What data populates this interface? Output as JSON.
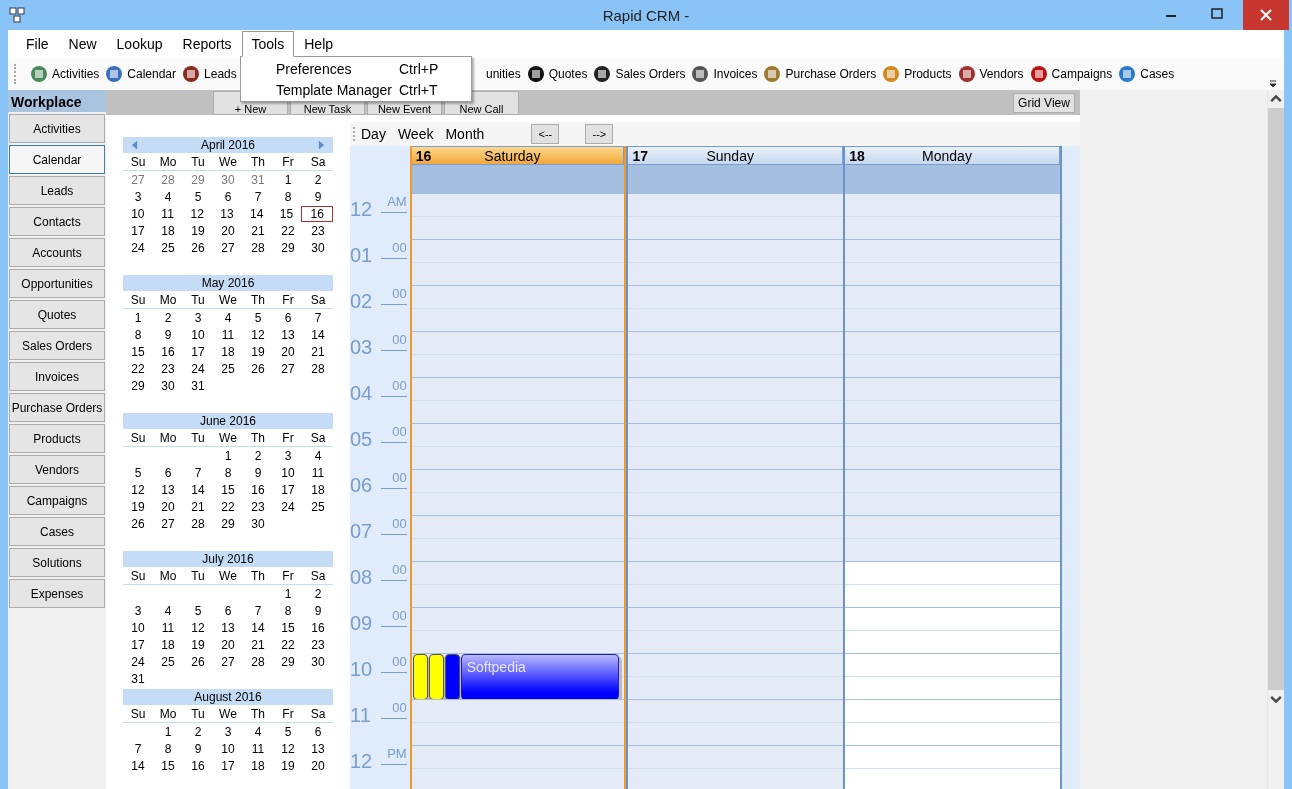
{
  "window": {
    "title": "Rapid CRM -"
  },
  "menu": [
    {
      "label": "File",
      "selected": false
    },
    {
      "label": "New",
      "selected": false
    },
    {
      "label": "Lookup",
      "selected": false
    },
    {
      "label": "Reports",
      "selected": false
    },
    {
      "label": "Tools",
      "selected": true
    },
    {
      "label": "Help",
      "selected": false
    }
  ],
  "dropdown": [
    {
      "label": "Preferences",
      "shortcut": "Ctrl+P"
    },
    {
      "label": "Template Manager",
      "shortcut": "Ctrl+T"
    }
  ],
  "toolbar": [
    {
      "label": "Activities",
      "icon": true
    },
    {
      "label": "Calendar",
      "icon": true
    },
    {
      "label": "Leads",
      "icon": true
    },
    {
      "label": "unities",
      "icon": false
    },
    {
      "label": "Quotes",
      "icon": true
    },
    {
      "label": "Sales Orders",
      "icon": true
    },
    {
      "label": "Invoices",
      "icon": true
    },
    {
      "label": "Purchase Orders",
      "icon": true
    },
    {
      "label": "Products",
      "icon": true
    },
    {
      "label": "Vendors",
      "icon": true
    },
    {
      "label": "Campaigns",
      "icon": true
    },
    {
      "label": "Cases",
      "icon": true
    }
  ],
  "sidebar": {
    "title": "Workplace",
    "items": [
      {
        "label": "Activities",
        "selected": false
      },
      {
        "label": "Calendar",
        "selected": true
      },
      {
        "label": "Leads",
        "selected": false
      },
      {
        "label": "Contacts",
        "selected": false
      },
      {
        "label": "Accounts",
        "selected": false
      },
      {
        "label": "Opportunities",
        "selected": false
      },
      {
        "label": "Quotes",
        "selected": false
      },
      {
        "label": "Sales Orders",
        "selected": false
      },
      {
        "label": "Invoices",
        "selected": false
      },
      {
        "label": "Purchase Orders",
        "selected": false
      },
      {
        "label": "Products",
        "selected": false
      },
      {
        "label": "Vendors",
        "selected": false
      },
      {
        "label": "Campaigns",
        "selected": false
      },
      {
        "label": "Cases",
        "selected": false
      },
      {
        "label": "Solutions",
        "selected": false
      },
      {
        "label": "Expenses",
        "selected": false
      }
    ]
  },
  "actions": [
    "+ New",
    "New Task",
    "New Event",
    "New Call"
  ],
  "grid_view_button": "Grid View",
  "months": [
    {
      "title": "April 2016",
      "nav": true,
      "weekdays": [
        "Su",
        "Mo",
        "Tu",
        "We",
        "Th",
        "Fr",
        "Sa"
      ],
      "weeks": [
        [
          {
            "day": "27",
            "other_month": true
          },
          {
            "day": "28",
            "other_month": true
          },
          {
            "day": "29",
            "other_month": true
          },
          {
            "day": "30",
            "other_month": true
          },
          {
            "day": "31",
            "other_month": true
          },
          "1",
          "2"
        ],
        [
          "3",
          "4",
          "5",
          "6",
          "7",
          "8",
          "9"
        ],
        [
          "10",
          "11",
          "12",
          "13",
          "14",
          "15",
          {
            "day": "16",
            "selected": true
          }
        ],
        [
          "17",
          "18",
          "19",
          "20",
          "21",
          "22",
          "23"
        ],
        [
          "24",
          "25",
          "26",
          "27",
          "28",
          "29",
          "30"
        ]
      ]
    },
    {
      "title": "May 2016",
      "nav": false,
      "weekdays": [
        "Su",
        "Mo",
        "Tu",
        "We",
        "Th",
        "Fr",
        "Sa"
      ],
      "weeks": [
        [
          "1",
          "2",
          "3",
          "4",
          "5",
          "6",
          "7"
        ],
        [
          "8",
          "9",
          "10",
          "11",
          "12",
          "13",
          "14"
        ],
        [
          "15",
          "16",
          "17",
          "18",
          "19",
          "20",
          "21"
        ],
        [
          "22",
          "23",
          "24",
          "25",
          "26",
          "27",
          "28"
        ],
        [
          "29",
          "30",
          "31"
        ]
      ]
    },
    {
      "title": "June 2016",
      "nav": false,
      "weekdays": [
        "Su",
        "Mo",
        "Tu",
        "We",
        "Th",
        "Fr",
        "Sa"
      ],
      "weeks": [
        [
          "1",
          "2",
          "3",
          "4"
        ],
        [
          "5",
          "6",
          "7",
          "8",
          "9",
          "10",
          "11"
        ],
        [
          "12",
          "13",
          "14",
          "15",
          "16",
          "17",
          "18"
        ],
        [
          "19",
          "20",
          "21",
          "22",
          "23",
          "24",
          "25"
        ],
        [
          "26",
          "27",
          "28",
          "29",
          "30"
        ]
      ]
    },
    {
      "title": "July 2016",
      "nav": false,
      "weekdays": [
        "Su",
        "Mo",
        "Tu",
        "We",
        "Th",
        "Fr",
        "Sa"
      ],
      "weeks": [
        [
          "1",
          "2"
        ],
        [
          "3",
          "4",
          "5",
          "6",
          "7",
          "8",
          "9"
        ],
        [
          "10",
          "11",
          "12",
          "13",
          "14",
          "15",
          "16"
        ],
        [
          "17",
          "18",
          "19",
          "20",
          "21",
          "22",
          "23"
        ],
        [
          "24",
          "25",
          "26",
          "27",
          "28",
          "29",
          "30"
        ],
        [
          "31"
        ]
      ]
    },
    {
      "title": "August 2016",
      "nav": false,
      "weekdays": [
        "Su",
        "Mo",
        "Tu",
        "We",
        "Th",
        "Fr",
        "Sa"
      ],
      "weeks": [
        [
          "1",
          "2",
          "3",
          "4",
          "5",
          "6"
        ],
        [
          "7",
          "8",
          "9",
          "10",
          "11",
          "12",
          "13"
        ],
        [
          "14",
          "15",
          "16",
          "17",
          "18",
          "19",
          "20"
        ]
      ]
    }
  ],
  "views": [
    "Day",
    "Week",
    "Month"
  ],
  "nav_buttons": [
    "<--",
    "-->"
  ],
  "days": [
    {
      "date": "16",
      "name": "Saturday",
      "selected": true,
      "working": false
    },
    {
      "date": "17",
      "name": "Sunday",
      "selected": false,
      "working": false
    },
    {
      "date": "18",
      "name": "Monday",
      "selected": false,
      "working": true
    }
  ],
  "hours": [
    {
      "hour": "12",
      "suffix": "AM",
      "working": false
    },
    {
      "hour": "01",
      "suffix": "00",
      "working": false
    },
    {
      "hour": "02",
      "suffix": "00",
      "working": false
    },
    {
      "hour": "03",
      "suffix": "00",
      "working": false
    },
    {
      "hour": "04",
      "suffix": "00",
      "working": false
    },
    {
      "hour": "05",
      "suffix": "00",
      "working": false
    },
    {
      "hour": "06",
      "suffix": "00",
      "working": false
    },
    {
      "hour": "07",
      "suffix": "00",
      "working": false
    },
    {
      "hour": "08",
      "suffix": "00",
      "working": true
    },
    {
      "hour": "09",
      "suffix": "00",
      "working": true
    },
    {
      "hour": "10",
      "suffix": "00",
      "working": true,
      "events": [
        {
          "color": "#ffff00"
        },
        {
          "color": "#ffff00"
        },
        {
          "color": "#0000ff"
        },
        {
          "color": "#0000ff",
          "title": "Softpedia"
        }
      ]
    },
    {
      "hour": "11",
      "suffix": "00",
      "working": true
    },
    {
      "hour": "12",
      "suffix": "PM",
      "working": true
    }
  ]
}
